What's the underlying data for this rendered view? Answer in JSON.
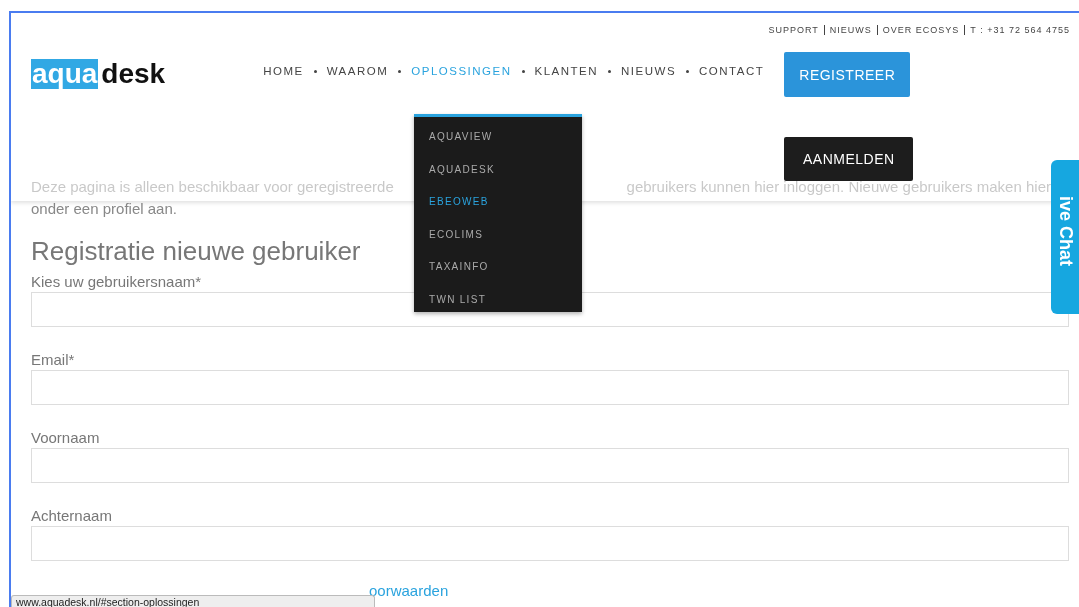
{
  "top_bar": {
    "links": [
      "SUPPORT",
      "NIEUWS",
      "OVER ECOSYS"
    ],
    "phone": "T : +31 72 564 4755"
  },
  "logo": {
    "highlight": "aqua",
    "rest": "desk"
  },
  "nav": [
    {
      "label": "HOME",
      "selected": false
    },
    {
      "label": "WAAROM",
      "selected": false
    },
    {
      "label": "OPLOSSINGEN",
      "selected": true
    },
    {
      "label": "KLANTEN",
      "selected": false
    },
    {
      "label": "NIEUWS",
      "selected": false
    },
    {
      "label": "CONTACT",
      "selected": false
    }
  ],
  "buttons": {
    "register": "REGISTREER",
    "login": "AANMELDEN"
  },
  "dropdown": [
    {
      "label": "AQUAVIEW",
      "selected": false
    },
    {
      "label": "AQUADESK",
      "selected": false
    },
    {
      "label": "EBEOWEB",
      "selected": true
    },
    {
      "label": "ECOLIMS",
      "selected": false
    },
    {
      "label": "TAXAINFO",
      "selected": false
    },
    {
      "label": "TWN LIST",
      "selected": false
    }
  ],
  "intro": {
    "line1_start": "Deze pagina is alleen beschikbaar voor geregistreerde",
    "line1_end": "gebruikers kunnen hier inloggen. Nieuwe gebruikers maken hier",
    "line2": "onder een profiel aan."
  },
  "form": {
    "title": "Registratie nieuwe gebruiker",
    "fields": [
      {
        "label": "Kies uw gebruikersnaam*"
      },
      {
        "label": "Email*"
      },
      {
        "label": "Voornaam"
      },
      {
        "label": "Achternaam"
      }
    ],
    "terms_link": "oorwaarden"
  },
  "live_chat": "ive Chat",
  "status_url": "www.aquadesk.nl/#section-oplossingen"
}
